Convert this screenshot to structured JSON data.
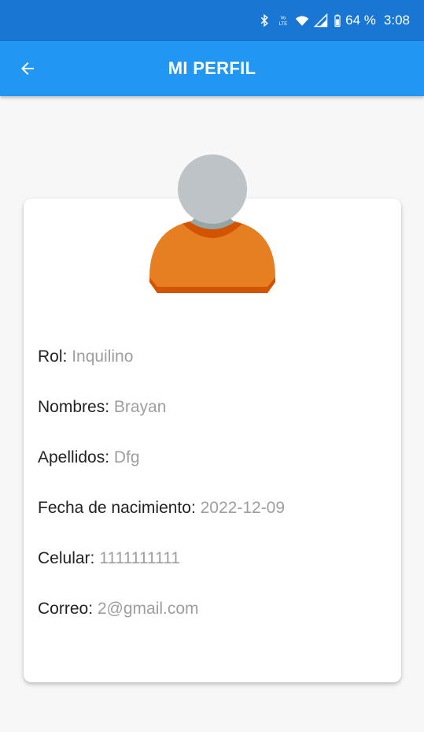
{
  "status_bar": {
    "battery_text": "64 %",
    "time": "3:08",
    "icons": [
      "bluetooth-icon",
      "volte-icon",
      "wifi-icon",
      "signal-icon",
      "battery-icon"
    ]
  },
  "app_bar": {
    "title": "MI PERFIL",
    "back_icon": "arrow-back-icon"
  },
  "profile": {
    "avatar_icon": "user-avatar-icon",
    "fields": [
      {
        "label": "Rol:",
        "value": "Inquilino"
      },
      {
        "label": "Nombres:",
        "value": "Brayan"
      },
      {
        "label": "Apellidos:",
        "value": "Dfg"
      },
      {
        "label": "Fecha de nacimiento:",
        "value": "2022-12-09"
      },
      {
        "label": "Celular:",
        "value": "1111111111"
      },
      {
        "label": "Correo:",
        "value": "2@gmail.com"
      }
    ]
  },
  "colors": {
    "status_bar": "#1976d2",
    "app_bar": "#2196f3",
    "label": "#222222",
    "value": "#9e9e9e",
    "avatar_head": "#bdc3c7",
    "avatar_body": "#e67e22"
  }
}
